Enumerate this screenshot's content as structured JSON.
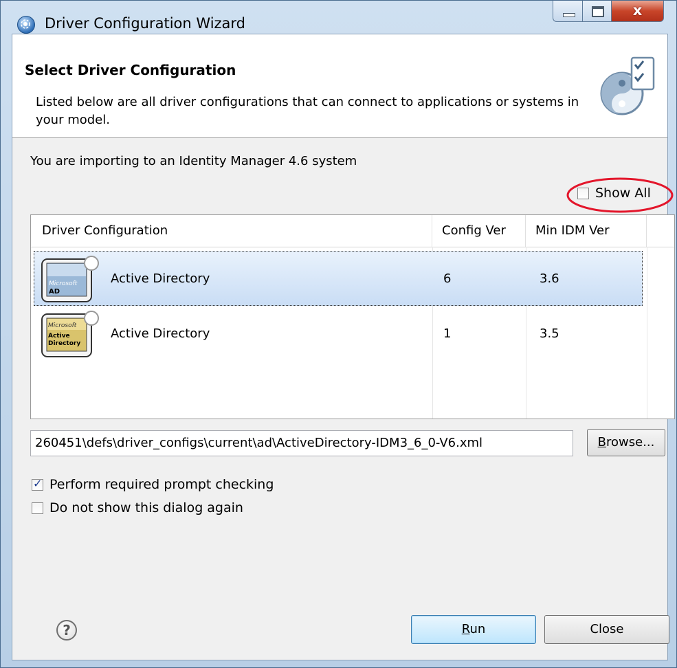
{
  "window": {
    "title": "Driver Configuration Wizard",
    "close_glyph": "x"
  },
  "header": {
    "title": "Select Driver Configuration",
    "description": "Listed below are all driver configurations that can connect to applications or systems in your model."
  },
  "import_text": "You are importing to an Identity Manager 4.6 system",
  "show_all": {
    "label": "Show All",
    "checked": false,
    "highlight_color": "#e3162b"
  },
  "table": {
    "columns": [
      "Driver Configuration",
      "Config Ver",
      "Min IDM Ver"
    ],
    "rows": [
      {
        "name": "Active Directory",
        "config_ver": "6",
        "min_idm_ver": "3.6",
        "icon": "microsoft-ad-icon",
        "icon_text": [
          "Microsoft",
          "AD"
        ],
        "selected": true
      },
      {
        "name": "Active Directory",
        "config_ver": "1",
        "min_idm_ver": "3.5",
        "icon": "microsoft-active-directory-icon",
        "icon_text": [
          "Microsoft",
          "Active",
          "Directory"
        ],
        "selected": false
      }
    ]
  },
  "path": {
    "value": "260451\\defs\\driver_configs\\current\\ad\\ActiveDirectory-IDM3_6_0-V6.xml"
  },
  "browse": {
    "label_underlined": "B",
    "label_rest": "rowse..."
  },
  "options": [
    {
      "label": "Perform required prompt checking",
      "checked": true
    },
    {
      "label": "Do not show this dialog again",
      "checked": false
    }
  ],
  "footer": {
    "help_glyph": "?",
    "run_underlined": "R",
    "run_rest": "un",
    "close_label": "Close"
  },
  "colors": {
    "selection": "#c9ddf5",
    "accent": "#3c7fb1"
  }
}
